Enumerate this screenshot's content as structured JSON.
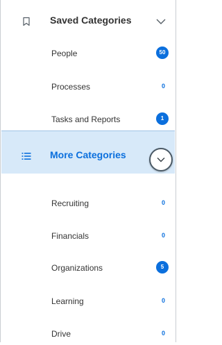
{
  "saved_categories": {
    "title": "Saved Categories",
    "icon": "bookmark-icon",
    "items": [
      {
        "label": "People",
        "count": "50",
        "badge": true
      },
      {
        "label": "Processes",
        "count": "0",
        "badge": false
      },
      {
        "label": "Tasks and Reports",
        "count": "1",
        "badge": true
      }
    ]
  },
  "more_categories": {
    "title": "More Categories",
    "icon": "list-icon",
    "items": [
      {
        "label": "Recruiting",
        "count": "0",
        "badge": false
      },
      {
        "label": "Financials",
        "count": "0",
        "badge": false
      },
      {
        "label": "Organizations",
        "count": "5",
        "badge": true
      },
      {
        "label": "Learning",
        "count": "0",
        "badge": false
      },
      {
        "label": "Drive",
        "count": "0",
        "badge": false
      }
    ]
  },
  "colors": {
    "accent": "#0b6fdd",
    "selected_header_bg": "#d7e9f9",
    "text": "#333333"
  }
}
